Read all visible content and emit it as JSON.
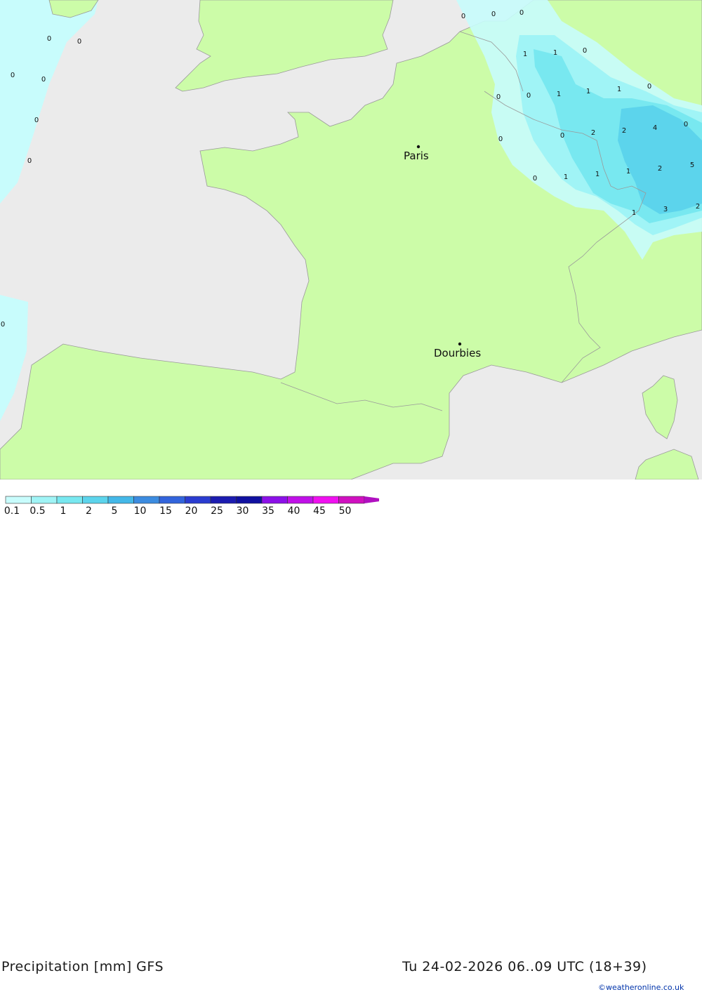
{
  "map": {
    "colors": {
      "sea": "#ebebeb",
      "land": "#ccfca8",
      "border": "#9a9a9a",
      "p01": "#c8fcfc",
      "p05": "#a0f4f6",
      "p1": "#78e8f0",
      "p2": "#5cd4ec"
    },
    "cities": [
      {
        "name": "Paris"
      },
      {
        "name": "Dourbies"
      }
    ],
    "grid_values": [
      "0",
      "0",
      "0",
      "0",
      "0",
      "0",
      "0",
      "0",
      "0",
      "0",
      "0",
      "0",
      "1",
      "1",
      "0",
      "0",
      "0",
      "1",
      "1",
      "1",
      "0",
      "0",
      "0",
      "2",
      "2",
      "4",
      "0",
      "0",
      "0",
      "1",
      "1",
      "1",
      "2",
      "5",
      "1",
      "3",
      "2",
      "0",
      "0",
      "0"
    ]
  },
  "legend": {
    "title": "Precipitation [mm] GFS",
    "date": "Tu 24-02-2026 06..09 UTC (18+39)",
    "credit": "©weatheronline.co.uk",
    "ticks": [
      "0.1",
      "0.5",
      "1",
      "2",
      "5",
      "10",
      "15",
      "20",
      "25",
      "30",
      "35",
      "40",
      "45",
      "50"
    ],
    "colors": [
      "#c8fcfc",
      "#a0f4f6",
      "#78e8f0",
      "#5cd4ec",
      "#44b8e8",
      "#3c8ce0",
      "#3264dc",
      "#2a3cd0",
      "#1c1cb0",
      "#1010a0",
      "#8c10e8",
      "#c010e8",
      "#f010f0",
      "#d010c0"
    ]
  }
}
